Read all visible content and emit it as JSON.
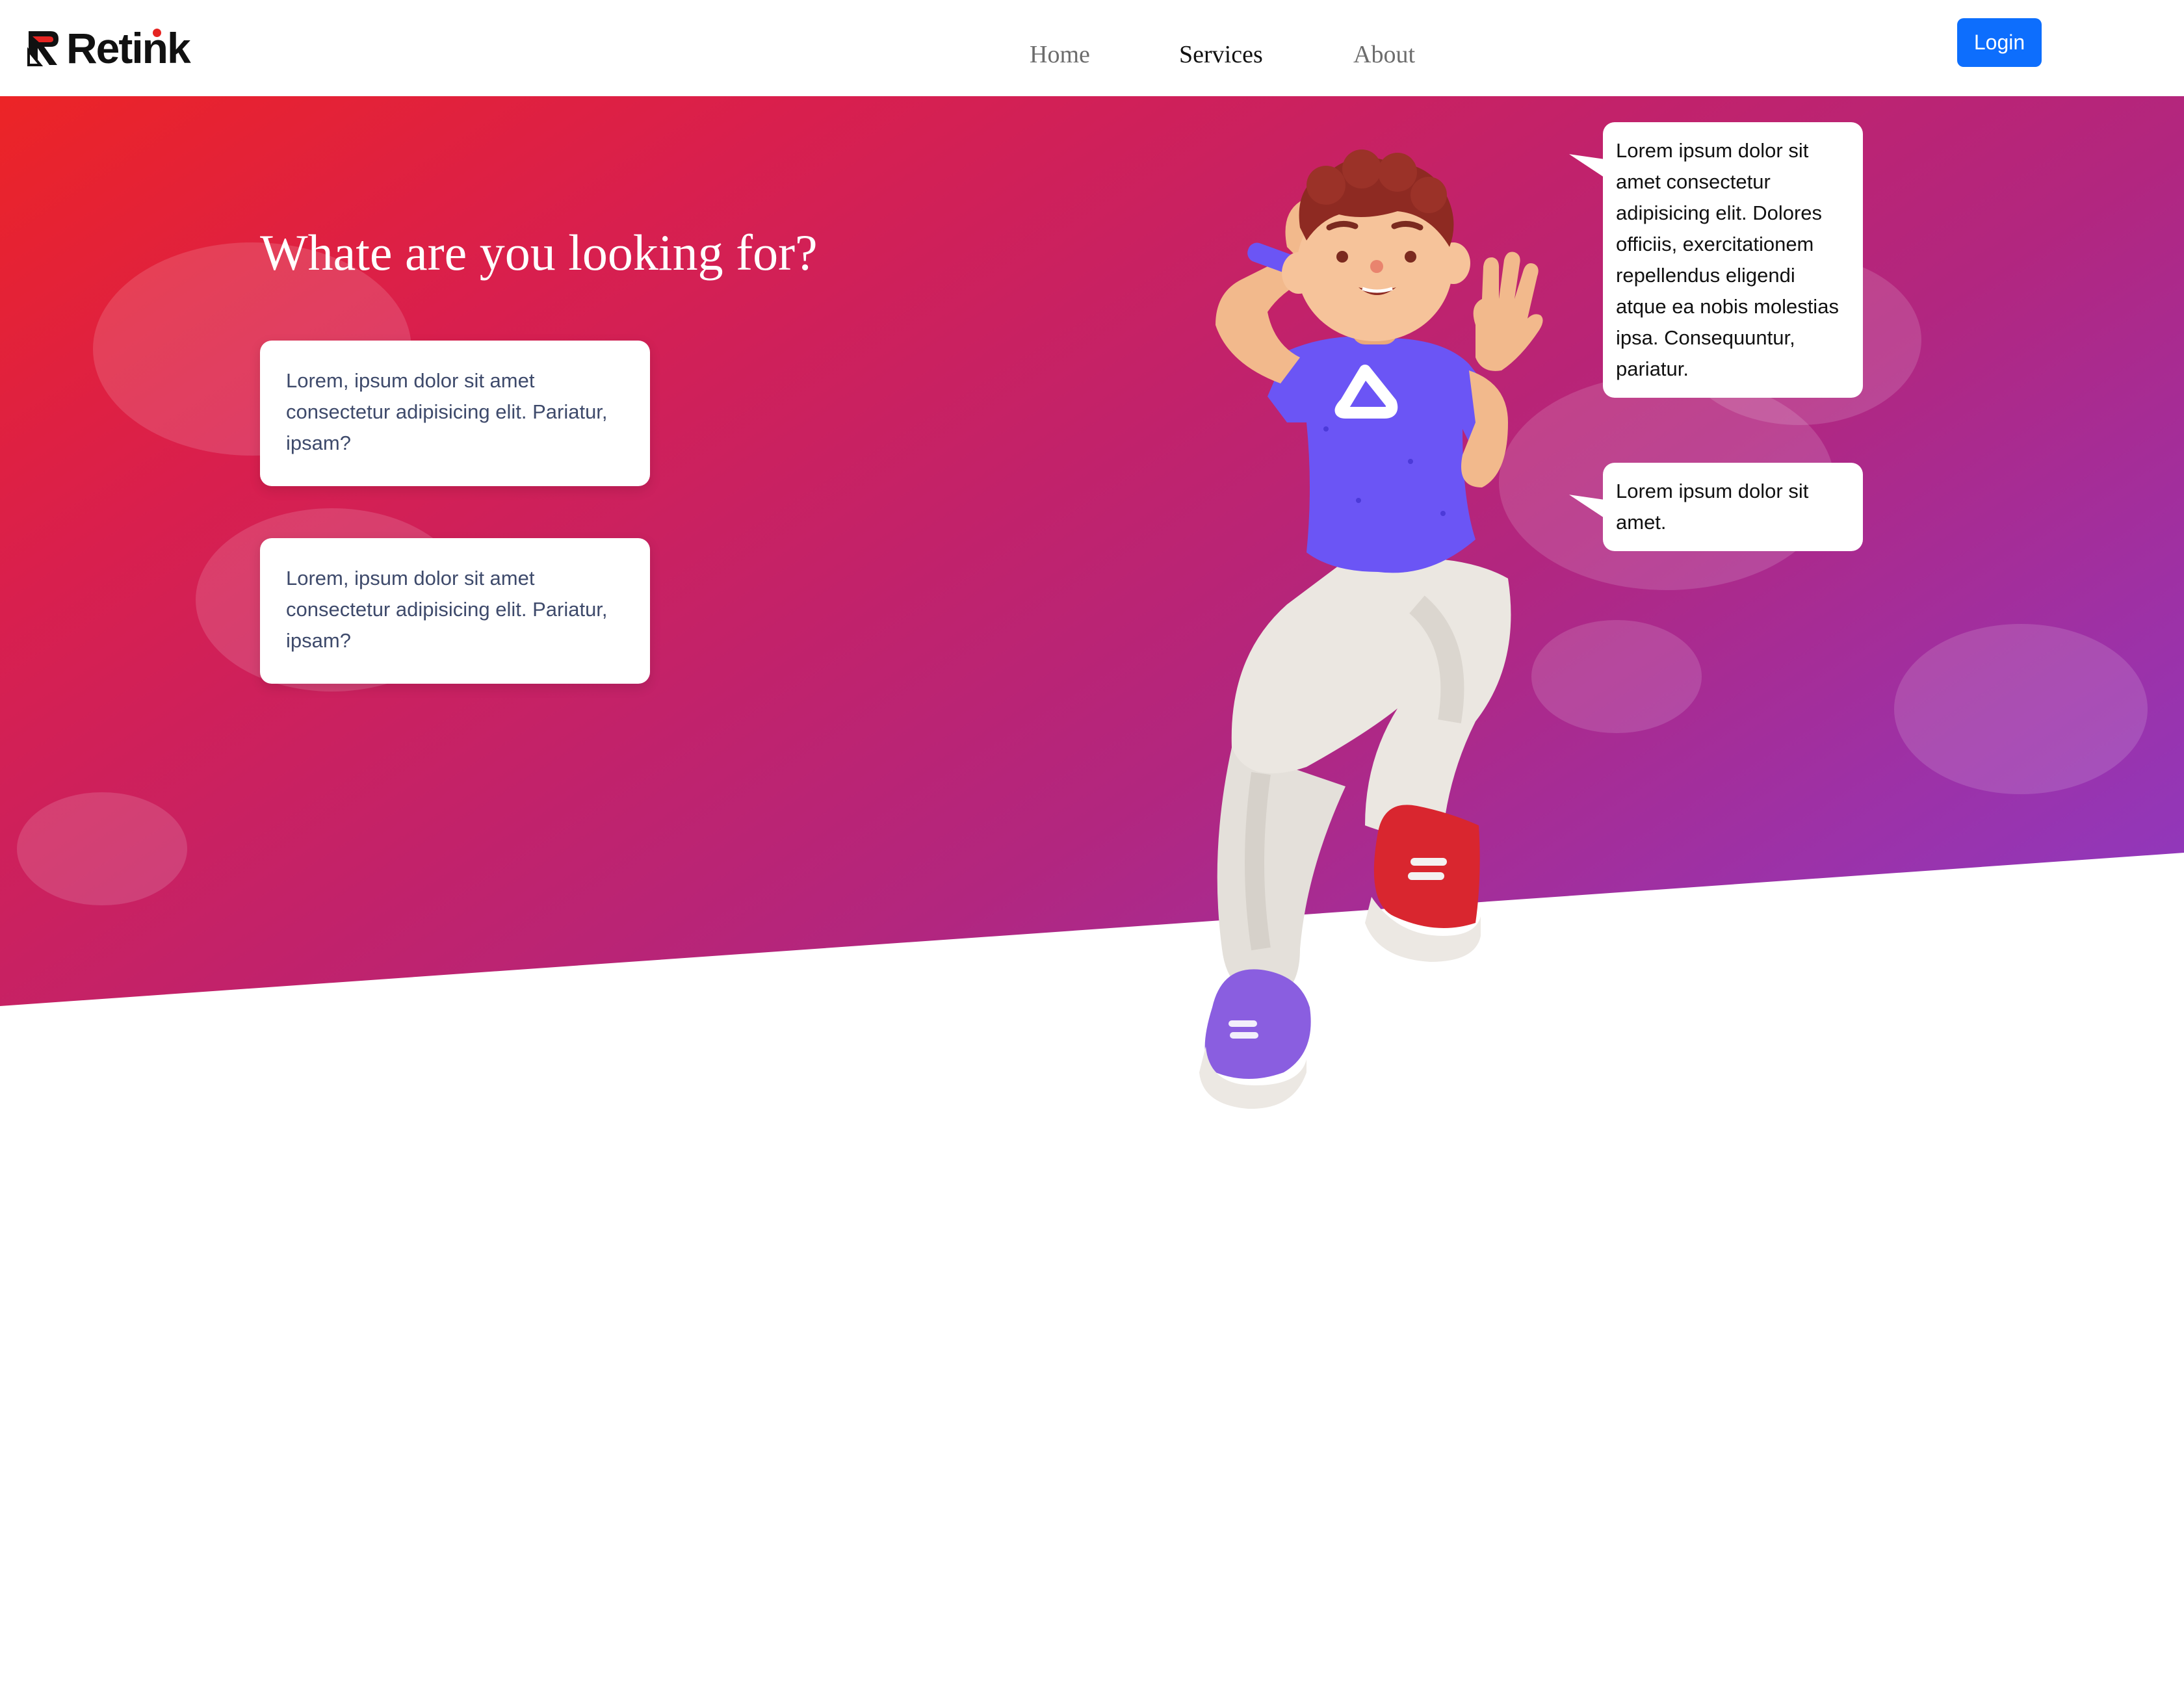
{
  "brand": {
    "name": "Retink",
    "accent_color": "#e52421"
  },
  "nav": {
    "links": [
      {
        "label": "Home",
        "active": false
      },
      {
        "label": "Services",
        "active": true
      },
      {
        "label": "About",
        "active": false
      }
    ],
    "login_label": "Login",
    "login_color": "#0d6efd"
  },
  "hero": {
    "title": "Whate are you looking for?",
    "cards": [
      {
        "text": "Lorem, ipsum dolor sit amet consectetur adipisicing elit. Pariatur, ipsam?"
      },
      {
        "text": "Lorem, ipsum dolor sit amet consectetur adipisicing elit. Pariatur, ipsam?"
      }
    ],
    "speech_bubbles": [
      {
        "text": "Lorem ipsum dolor sit amet consectetur adipisicing elit. Dolores officiis, exercitationem repellendus eligendi atque ea nobis molestias ipsa. Consequuntur, pariatur."
      },
      {
        "text": "Lorem ipsum dolor sit amet."
      }
    ],
    "gradient_colors": [
      "#ec2426",
      "#c2226a",
      "#8b3bc6"
    ]
  },
  "illustration": {
    "icon": "waving-character-illustration",
    "shirt_color": "#6b55f5",
    "pants_color": "#e8e4df",
    "left_shoe_color": "#8a5ee0",
    "right_shoe_color": "#d9262f"
  }
}
